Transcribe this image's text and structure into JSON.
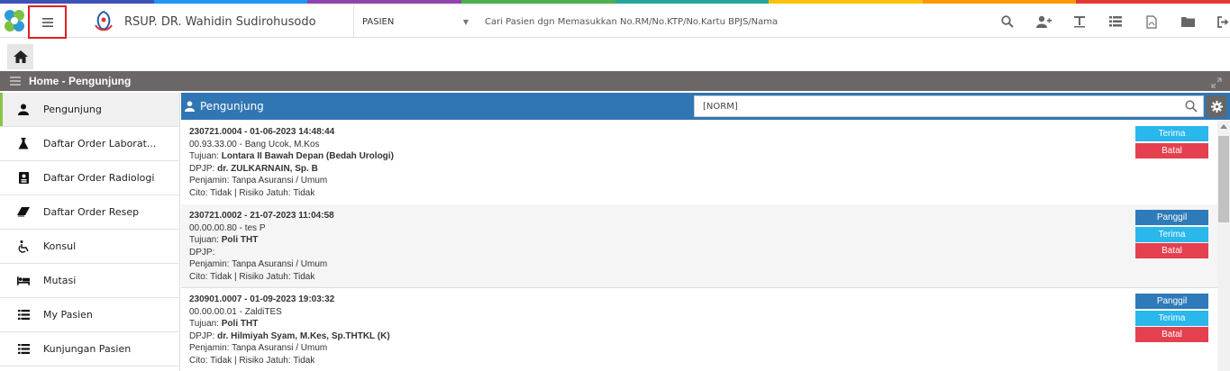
{
  "header": {
    "hospital_name": "RSUP. DR. Wahidin Sudirohusodo",
    "search_type": "PASIEN",
    "search_placeholder": "Cari Pasien dgn Memasukkan No.RM/No.KTP/No.Kartu BPJS/Nama",
    "icons": [
      "search-icon",
      "add-user-icon",
      "text-icon",
      "list-icon",
      "pdf-icon",
      "folder-icon",
      "logout-icon"
    ]
  },
  "breadcrumb": "Home - Pengunjung",
  "sidebar": {
    "items": [
      {
        "label": "Pengunjung",
        "icon": "user-icon",
        "active": true
      },
      {
        "label": "Daftar Order Laborat...",
        "icon": "flask-icon"
      },
      {
        "label": "Daftar Order Radiologi",
        "icon": "radiology-icon"
      },
      {
        "label": "Daftar Order Resep",
        "icon": "eraser-icon"
      },
      {
        "label": "Konsul",
        "icon": "wheelchair-icon"
      },
      {
        "label": "Mutasi",
        "icon": "bed-icon"
      },
      {
        "label": "My Pasien",
        "icon": "list-icon"
      },
      {
        "label": "Kunjungan Pasien",
        "icon": "list-icon"
      }
    ]
  },
  "panel": {
    "title": "Pengunjung",
    "norm_value": "[NORM]"
  },
  "visits": [
    {
      "header": "230721.0004 - 01-06-2023 14:48:44",
      "patient": "00.93.33.00 - Bang Ucok, M.Kos",
      "tujuan_label": "Tujuan: ",
      "tujuan": "Lontara II Bawah Depan (Bedah Urologi)",
      "dpjp_label": "DPJP: ",
      "dpjp": "dr. ZULKARNAIN, Sp. B",
      "penjamin": "Penjamin: Tanpa Asuransi / Umum",
      "cito": "Cito: Tidak | Risiko Jatuh: Tidak",
      "buttons": {
        "terima": "Terima",
        "batal": "Batal"
      }
    },
    {
      "header": "230721.0002 - 21-07-2023 11:04:58",
      "patient": "00.00.00.80 - tes P",
      "tujuan_label": "Tujuan: ",
      "tujuan": "Poli THT",
      "dpjp_label": "DPJP:",
      "dpjp": "",
      "penjamin": "Penjamin: Tanpa Asuransi / Umum",
      "cito": "Cito: Tidak | Risiko Jatuh: Tidak",
      "buttons": {
        "panggil": "Panggil",
        "terima": "Terima",
        "batal": "Batal"
      }
    },
    {
      "header": "230901.0007 - 01-09-2023 19:03:32",
      "patient": "00.00.00.01 - ZaldiTES",
      "tujuan_label": "Tujuan: ",
      "tujuan": "Poli THT",
      "dpjp_label": "DPJP: ",
      "dpjp": "dr. Hilmiyah Syam, M.Kes, Sp.THTKL (K)",
      "penjamin": "Penjamin: Tanpa Asuransi / Umum",
      "cito": "Cito: Tidak | Risiko Jatuh: Tidak",
      "buttons": {
        "panggil": "Panggil",
        "terima": "Terima",
        "batal": "Batal"
      }
    }
  ],
  "colors": {
    "panel_blue": "#3176b4",
    "breadcrumb_bar": "#6b6766",
    "panggil": "#2f7ab8",
    "terima": "#29b7ec",
    "batal": "#e5404f",
    "active_indicator": "#8bc34a",
    "highlight_border": "#e02020"
  }
}
